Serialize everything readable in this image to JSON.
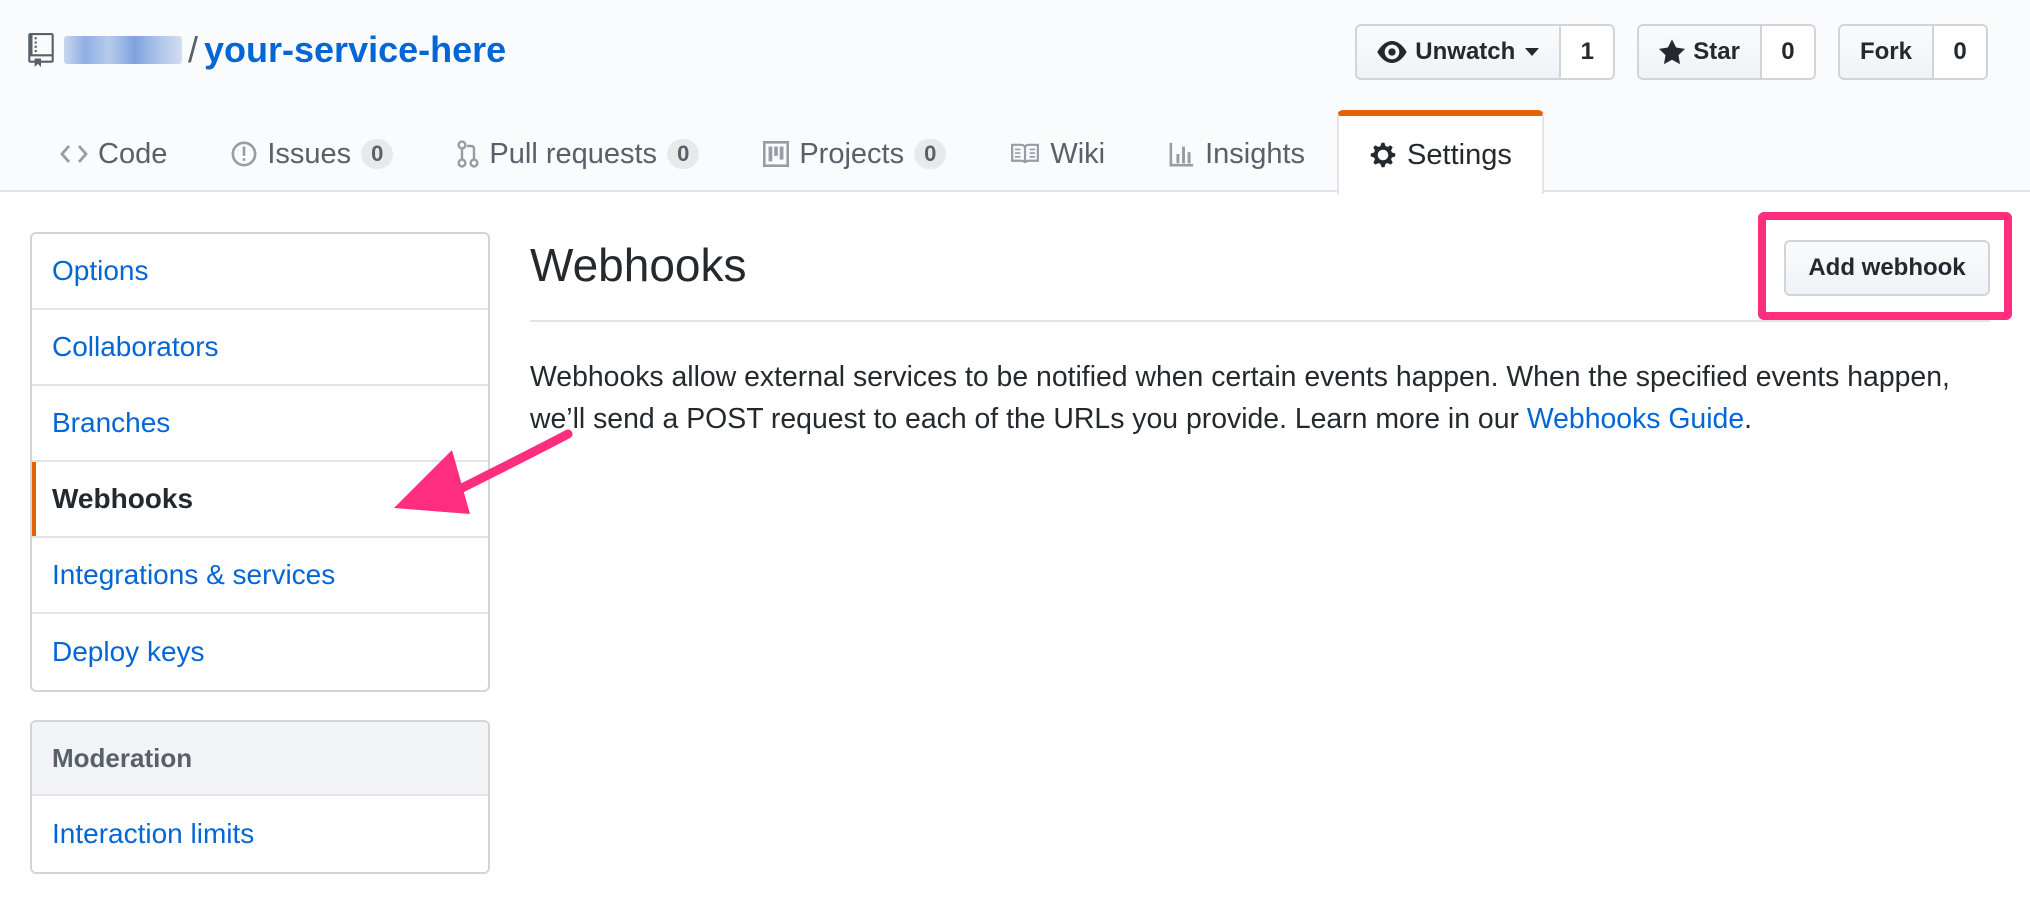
{
  "repo": {
    "separator": "/",
    "name": "your-service-here"
  },
  "actions": {
    "watch": {
      "label": "Unwatch",
      "count": "1"
    },
    "star": {
      "label": "Star",
      "count": "0"
    },
    "fork": {
      "label": "Fork",
      "count": "0"
    }
  },
  "tabs": [
    {
      "label": "Code"
    },
    {
      "label": "Issues",
      "count": "0"
    },
    {
      "label": "Pull requests",
      "count": "0"
    },
    {
      "label": "Projects",
      "count": "0"
    },
    {
      "label": "Wiki"
    },
    {
      "label": "Insights"
    },
    {
      "label": "Settings",
      "selected": true
    }
  ],
  "sidebar": {
    "items": [
      {
        "label": "Options"
      },
      {
        "label": "Collaborators"
      },
      {
        "label": "Branches"
      },
      {
        "label": "Webhooks",
        "selected": true
      },
      {
        "label": "Integrations & services"
      },
      {
        "label": "Deploy keys"
      }
    ],
    "moderation": {
      "heading": "Moderation",
      "items": [
        {
          "label": "Interaction limits"
        }
      ]
    }
  },
  "main": {
    "title": "Webhooks",
    "add_button": "Add webhook",
    "description_text": "Webhooks allow external services to be notified when certain events happen. When the specified events happen, we’ll send a POST request to each of the URLs you provide. Learn more in our ",
    "description_link": "Webhooks Guide",
    "description_end": "."
  },
  "colors": {
    "link": "#0366d6",
    "accent": "#e36209",
    "annotation": "#ff2d7d"
  }
}
